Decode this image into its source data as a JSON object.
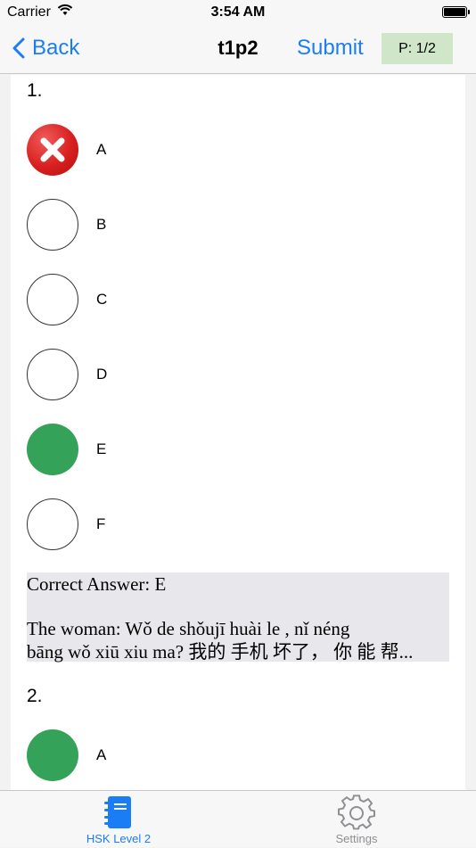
{
  "status_bar": {
    "carrier": "Carrier",
    "time": "3:54 AM"
  },
  "nav": {
    "back_label": "Back",
    "title": "t1p2",
    "submit_label": "Submit",
    "page_indicator": "P: 1/2"
  },
  "questions": [
    {
      "number": "1.",
      "options": [
        {
          "label": "A",
          "state": "wrong"
        },
        {
          "label": "B",
          "state": "empty"
        },
        {
          "label": "C",
          "state": "empty"
        },
        {
          "label": "D",
          "state": "empty"
        },
        {
          "label": "E",
          "state": "correct"
        },
        {
          "label": "F",
          "state": "empty"
        }
      ],
      "correct_answer": "Correct Answer: E",
      "explanation_line1": "The woman: Wǒ de shǒujī huài le ,   nǐ néng",
      "explanation_line2": "bāng wǒ xiū xiu ma?  我的 手机 坏了， 你 能 帮..."
    },
    {
      "number": "2.",
      "options": [
        {
          "label": "A",
          "state": "correct"
        }
      ]
    }
  ],
  "tab_bar": {
    "tabs": [
      {
        "label": "HSK Level 2",
        "icon": "notebook-icon",
        "active": true
      },
      {
        "label": "Settings",
        "icon": "gear-icon",
        "active": false
      }
    ]
  },
  "colors": {
    "accent": "#1a7df5",
    "correct": "#34a359",
    "wrong": "#d8201f",
    "page_indicator_bg": "#cfe6c8"
  }
}
